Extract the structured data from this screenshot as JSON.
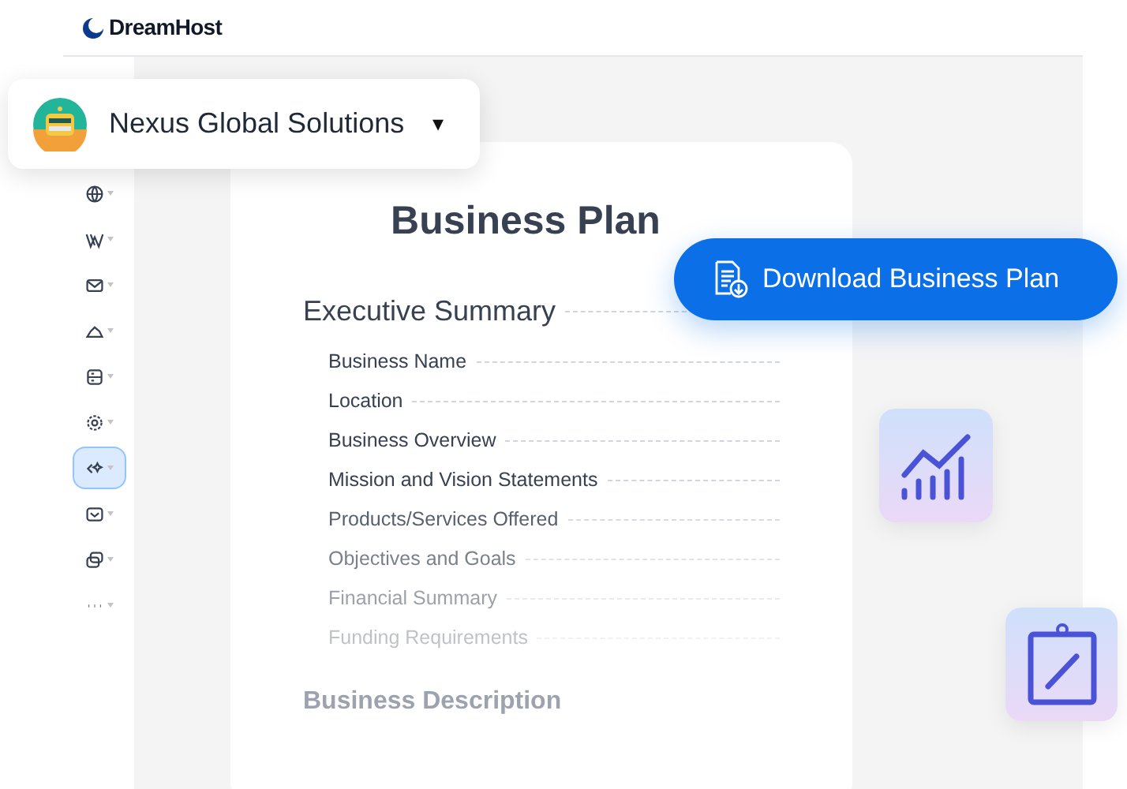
{
  "header": {
    "brand": "DreamHost"
  },
  "org_selector": {
    "name": "Nexus Global Solutions",
    "caret": "▾"
  },
  "sidebar": {
    "items": [
      {
        "selected": false
      },
      {
        "selected": false
      },
      {
        "selected": false
      },
      {
        "selected": false
      },
      {
        "selected": false
      },
      {
        "selected": false
      },
      {
        "selected": true
      },
      {
        "selected": false
      },
      {
        "selected": false
      },
      {
        "selected": false
      }
    ]
  },
  "document": {
    "title": "Business Plan",
    "section": "Executive Summary",
    "items": [
      "Business Name",
      "Location",
      "Business Overview",
      "Mission and Vision Statements",
      "Products/Services Offered",
      "Objectives and Goals",
      "Financial Summary",
      "Funding Requirements"
    ],
    "next_section": "Business Description"
  },
  "download_button": {
    "label": "Download Business Plan"
  }
}
